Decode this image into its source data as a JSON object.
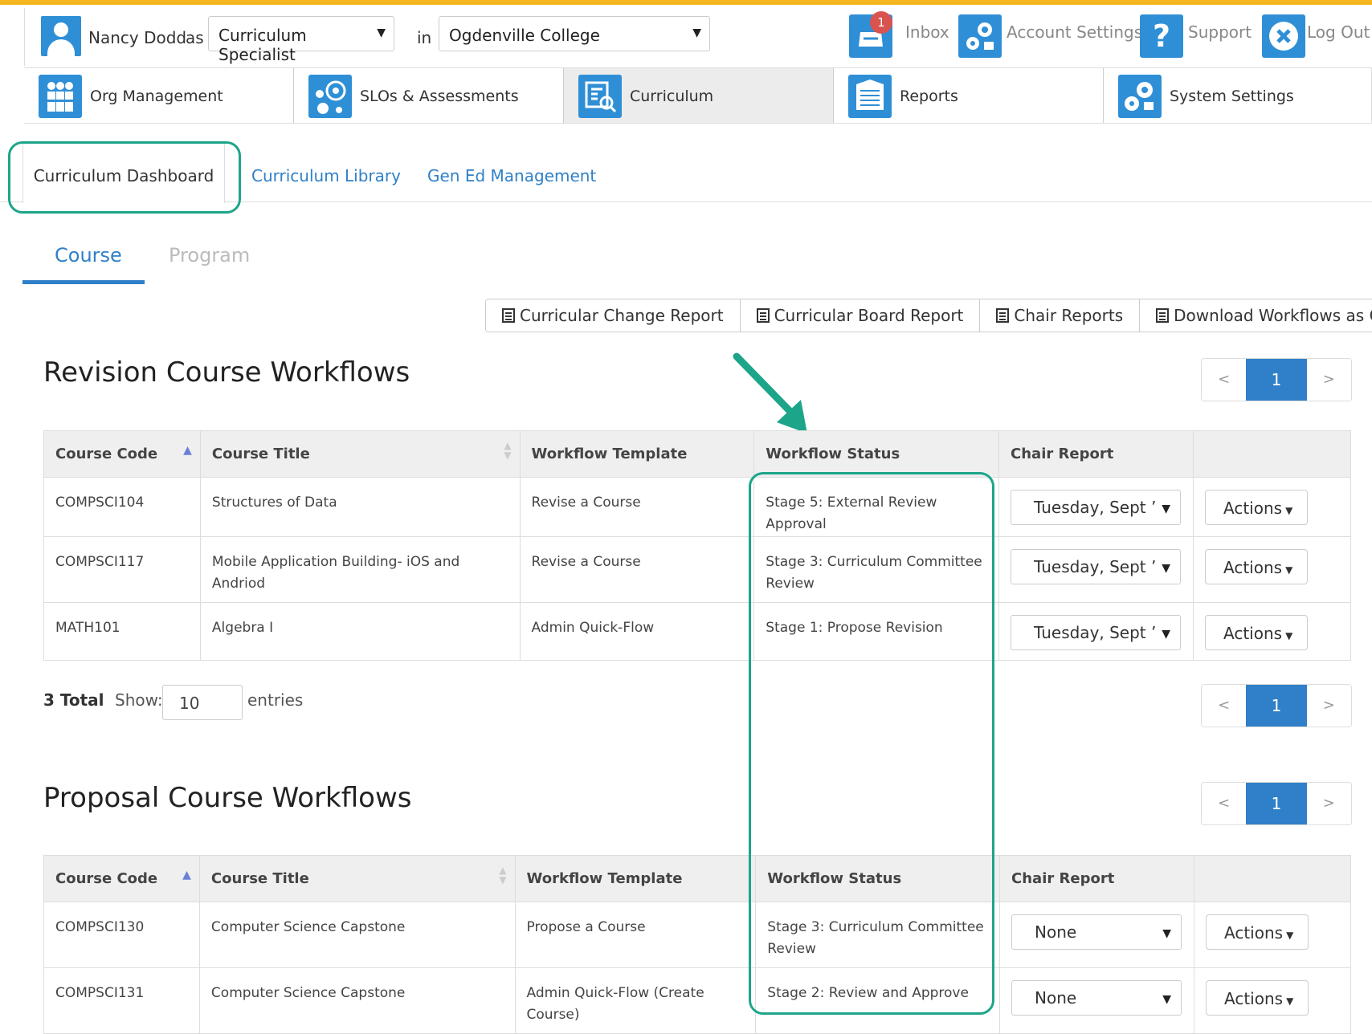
{
  "user": {
    "name": "Nancy Dodd",
    "as_label": "as",
    "role": "Curriculum Specialist",
    "in_label": "in",
    "institution": "Ogdenville College"
  },
  "header_links": {
    "inbox": "Inbox",
    "inbox_count": "1",
    "account_settings": "Account Settings",
    "support": "Support",
    "logout": "Log Out"
  },
  "modules": [
    {
      "label": "Org Management",
      "icon": "org-management-icon"
    },
    {
      "label": "SLOs & Assessments",
      "icon": "slos-icon"
    },
    {
      "label": "Curriculum",
      "icon": "curriculum-icon",
      "active": true
    },
    {
      "label": "Reports",
      "icon": "reports-icon"
    },
    {
      "label": "System Settings",
      "icon": "system-settings-icon"
    }
  ],
  "subtabs": {
    "dashboard": "Curriculum Dashboard",
    "library": "Curriculum Library",
    "gened": "Gen Ed Management"
  },
  "pills": {
    "course": "Course",
    "program": "Program"
  },
  "report_buttons": {
    "change": "Curricular Change Report",
    "board": "Curricular Board Report",
    "chair": "Chair Reports",
    "csv": "Download Workflows as CSV"
  },
  "pager": {
    "prev": "<",
    "current": "1",
    "next": ">"
  },
  "revision": {
    "title": "Revision Course Workflows",
    "headers": {
      "code": "Course Code",
      "title": "Course Title",
      "template": "Workflow Template",
      "status": "Workflow Status",
      "chair": "Chair Report"
    },
    "rows": [
      {
        "code": "COMPSCI104",
        "title": "Structures of Data",
        "template": "Revise a Course",
        "status": "Stage 5: External Review Approval",
        "chair": "Tuesday, Sept ’",
        "actions": "Actions"
      },
      {
        "code": "COMPSCI117",
        "title": "Mobile Application Building- iOS and Andriod",
        "template": "Revise a Course",
        "status": "Stage 3: Curriculum Committee Review",
        "chair": "Tuesday, Sept ’",
        "actions": "Actions"
      },
      {
        "code": "MATH101",
        "title": "Algebra I",
        "template": "Admin Quick-Flow",
        "status": "Stage 1: Propose Revision",
        "chair": "Tuesday, Sept ’",
        "actions": "Actions"
      }
    ],
    "total": "3 Total",
    "show_label": "Show:",
    "show_value": "10",
    "entries_label": "entries"
  },
  "proposal": {
    "title": "Proposal Course Workflows",
    "headers": {
      "code": "Course Code",
      "title": "Course Title",
      "template": "Workflow Template",
      "status": "Workflow Status",
      "chair": "Chair Report"
    },
    "rows": [
      {
        "code": "COMPSCI130",
        "title": "Computer Science Capstone",
        "template": "Propose a Course",
        "status": "Stage 3: Curriculum Committee Review",
        "chair": "None",
        "actions": "Actions"
      },
      {
        "code": "COMPSCI131",
        "title": "Computer Science Capstone",
        "template": "Admin Quick-Flow (Create Course)",
        "status": "Stage 2: Review and Approve",
        "chair": "None",
        "actions": "Actions"
      }
    ]
  },
  "colors": {
    "accent": "#2f80c8",
    "icon_blue": "#2f8fd6",
    "annotation_green": "#1da58a",
    "top_bar": "#f5b51e"
  }
}
